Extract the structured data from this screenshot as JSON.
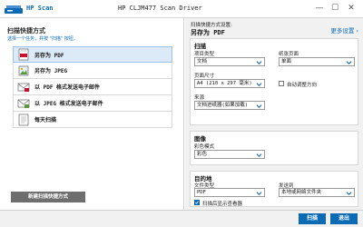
{
  "titlebar": {
    "app_name": "HP Scan",
    "window_title": "HP CLJM477 Scan Driver",
    "minimize": "—",
    "maximize": "☐",
    "close": "✕"
  },
  "left": {
    "heading": "扫描快捷方式",
    "subheading": "选择一个任务，并按 \"扫描\" 按钮。",
    "shortcuts": [
      {
        "label": "另存为 PDF",
        "icon": "pdf-icon"
      },
      {
        "label": "另存为 JPEG",
        "icon": "jpeg-icon"
      },
      {
        "label": "以 PDF 格式发送电子邮件",
        "icon": "email-pdf-icon"
      },
      {
        "label": "以 JPEG 格式发送电子邮件",
        "icon": "email-jpeg-icon"
      },
      {
        "label": "每天扫描",
        "icon": "scan-icon"
      }
    ],
    "new_shortcut_button": "新建扫描快捷方式"
  },
  "right": {
    "current_label": "扫描快捷方式设置:",
    "current_name": "另存为 PDF",
    "more_settings": "更多设置",
    "scan_section": {
      "title": "扫描",
      "item_type_label": "项目类型",
      "item_type_value": "文档",
      "page_sides_label": "纸张页面",
      "page_sides_value": "单面",
      "page_size_label": "页面尺寸",
      "page_size_value": "A4 (210 x 297 毫米)",
      "auto_orient_label": "自动调整方向",
      "auto_orient_checked": false,
      "source_label": "来源",
      "source_value": "文档进纸器(如果加载)"
    },
    "image_section": {
      "title": "图像",
      "color_mode_label": "彩色模式",
      "color_mode_value": "彩色"
    },
    "destination_section": {
      "title": "目的地",
      "file_type_label": "文件类型",
      "file_type_value": "PDF",
      "send_to_label": "发送到",
      "send_to_value": "本地或网络文件夹",
      "show_viewer_label": "扫描后显示查看器",
      "show_viewer_checked": true
    }
  },
  "footer": {
    "scan_button": "扫描",
    "exit_button": "退出"
  },
  "colors": {
    "accent": "#0a6ab3",
    "selected_row": "#dce9f7",
    "panel_bg": "#f1f1f1"
  }
}
